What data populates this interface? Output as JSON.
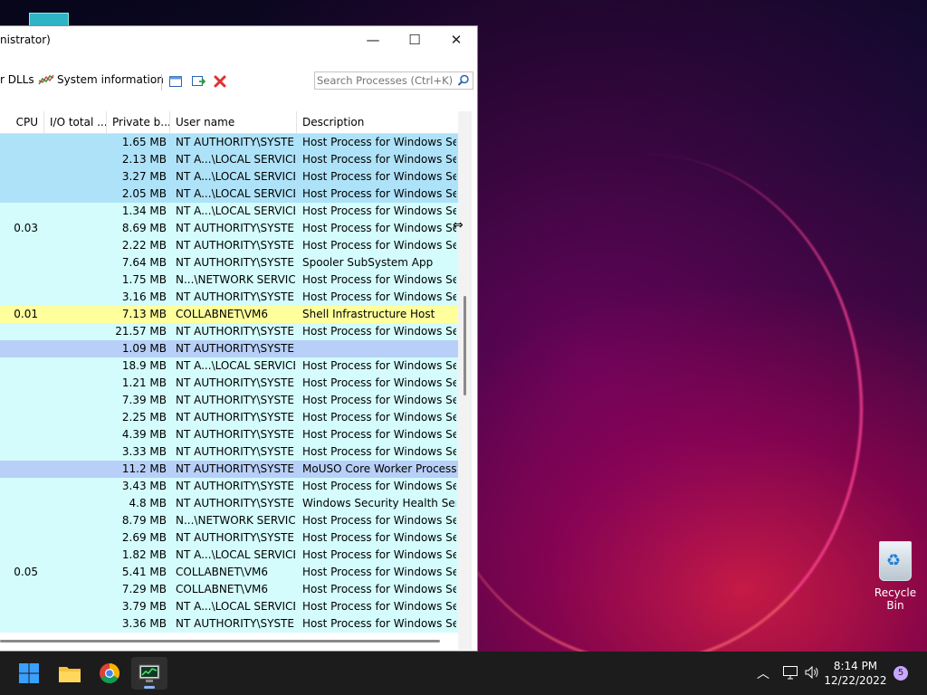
{
  "window": {
    "title": "nistrator)",
    "minimize": "—",
    "maximize": "☐",
    "close": "✕"
  },
  "toolbar": {
    "dlls_label": "r DLLs",
    "sysinfo_label": "System information",
    "search_placeholder": "Search Processes (Ctrl+K)"
  },
  "columns": {
    "cpu": "CPU",
    "io": "I/O total ...",
    "private": "Private b...",
    "user": "User name",
    "description": "Description"
  },
  "colors": {
    "service": "#aee2f8",
    "process": "#d4fcfc",
    "own": "#ffff9c",
    "selected": "#b8d0f8"
  },
  "rows": [
    {
      "cpu": "",
      "priv": "1.65 MB",
      "user": "NT AUTHORITY\\SYSTEM",
      "desc": "Host Process for Windows Ser...",
      "kind": "service"
    },
    {
      "cpu": "",
      "priv": "2.13 MB",
      "user": "NT A...\\LOCAL SERVICE",
      "desc": "Host Process for Windows Ser...",
      "kind": "service"
    },
    {
      "cpu": "",
      "priv": "3.27 MB",
      "user": "NT A...\\LOCAL SERVICE",
      "desc": "Host Process for Windows Ser...",
      "kind": "service"
    },
    {
      "cpu": "",
      "priv": "2.05 MB",
      "user": "NT A...\\LOCAL SERVICE",
      "desc": "Host Process for Windows Ser...",
      "kind": "service"
    },
    {
      "cpu": "",
      "priv": "1.34 MB",
      "user": "NT A...\\LOCAL SERVICE",
      "desc": "Host Process for Windows Ser...",
      "kind": "process"
    },
    {
      "cpu": "0.03",
      "priv": "8.69 MB",
      "user": "NT AUTHORITY\\SYSTEM",
      "desc": "Host Process for Windows Ser...",
      "kind": "process"
    },
    {
      "cpu": "",
      "priv": "2.22 MB",
      "user": "NT AUTHORITY\\SYSTEM",
      "desc": "Host Process for Windows Ser...",
      "kind": "process"
    },
    {
      "cpu": "",
      "priv": "7.64 MB",
      "user": "NT AUTHORITY\\SYSTEM",
      "desc": "Spooler SubSystem App",
      "kind": "process"
    },
    {
      "cpu": "",
      "priv": "1.75 MB",
      "user": "N...\\NETWORK SERVICE",
      "desc": "Host Process for Windows Ser...",
      "kind": "process"
    },
    {
      "cpu": "",
      "priv": "3.16 MB",
      "user": "NT AUTHORITY\\SYSTEM",
      "desc": "Host Process for Windows Ser...",
      "kind": "process"
    },
    {
      "cpu": "0.01",
      "priv": "7.13 MB",
      "user": "COLLABNET\\VM6",
      "desc": "Shell Infrastructure Host",
      "kind": "own"
    },
    {
      "cpu": "",
      "priv": "21.57 MB",
      "user": "NT AUTHORITY\\SYSTEM",
      "desc": "Host Process for Windows Ser...",
      "kind": "process"
    },
    {
      "cpu": "",
      "priv": "1.09 MB",
      "user": "NT AUTHORITY\\SYSTEM",
      "desc": "",
      "kind": "selected"
    },
    {
      "cpu": "",
      "priv": "18.9 MB",
      "user": "NT A...\\LOCAL SERVICE",
      "desc": "Host Process for Windows Ser...",
      "kind": "process"
    },
    {
      "cpu": "",
      "priv": "1.21 MB",
      "user": "NT AUTHORITY\\SYSTEM",
      "desc": "Host Process for Windows Ser...",
      "kind": "process"
    },
    {
      "cpu": "",
      "priv": "7.39 MB",
      "user": "NT AUTHORITY\\SYSTEM",
      "desc": "Host Process for Windows Ser...",
      "kind": "process"
    },
    {
      "cpu": "",
      "priv": "2.25 MB",
      "user": "NT AUTHORITY\\SYSTEM",
      "desc": "Host Process for Windows Ser...",
      "kind": "process"
    },
    {
      "cpu": "",
      "priv": "4.39 MB",
      "user": "NT AUTHORITY\\SYSTEM",
      "desc": "Host Process for Windows Ser...",
      "kind": "process"
    },
    {
      "cpu": "",
      "priv": "3.33 MB",
      "user": "NT AUTHORITY\\SYSTEM",
      "desc": "Host Process for Windows Ser...",
      "kind": "process"
    },
    {
      "cpu": "",
      "priv": "11.2 MB",
      "user": "NT AUTHORITY\\SYSTEM",
      "desc": "MoUSO Core Worker Process",
      "kind": "selected"
    },
    {
      "cpu": "",
      "priv": "3.43 MB",
      "user": "NT AUTHORITY\\SYSTEM",
      "desc": "Host Process for Windows Ser...",
      "kind": "process"
    },
    {
      "cpu": "",
      "priv": "4.8 MB",
      "user": "NT AUTHORITY\\SYSTEM",
      "desc": "Windows Security Health Serv...",
      "kind": "process"
    },
    {
      "cpu": "",
      "priv": "8.79 MB",
      "user": "N...\\NETWORK SERVICE",
      "desc": "Host Process for Windows Ser...",
      "kind": "process"
    },
    {
      "cpu": "",
      "priv": "2.69 MB",
      "user": "NT AUTHORITY\\SYSTEM",
      "desc": "Host Process for Windows Ser...",
      "kind": "process"
    },
    {
      "cpu": "",
      "priv": "1.82 MB",
      "user": "NT A...\\LOCAL SERVICE",
      "desc": "Host Process for Windows Ser...",
      "kind": "process"
    },
    {
      "cpu": "0.05",
      "priv": "5.41 MB",
      "user": "COLLABNET\\VM6",
      "desc": "Host Process for Windows Ser...",
      "kind": "process"
    },
    {
      "cpu": "",
      "priv": "7.29 MB",
      "user": "COLLABNET\\VM6",
      "desc": "Host Process for Windows Ser...",
      "kind": "process"
    },
    {
      "cpu": "",
      "priv": "3.79 MB",
      "user": "NT A...\\LOCAL SERVICE",
      "desc": "Host Process for Windows Ser...",
      "kind": "process"
    },
    {
      "cpu": "",
      "priv": "3.36 MB",
      "user": "NT AUTHORITY\\SYSTEM",
      "desc": "Host Process for Windows Ser...",
      "kind": "process"
    }
  ],
  "desktop": {
    "recycle_bin": "Recycle Bin"
  },
  "taskbar": {
    "time": "8:14 PM",
    "date": "12/22/2022",
    "notification_count": "5",
    "apps": [
      "start-icon",
      "file-explorer-icon",
      "chrome-icon",
      "process-explorer-icon"
    ]
  }
}
